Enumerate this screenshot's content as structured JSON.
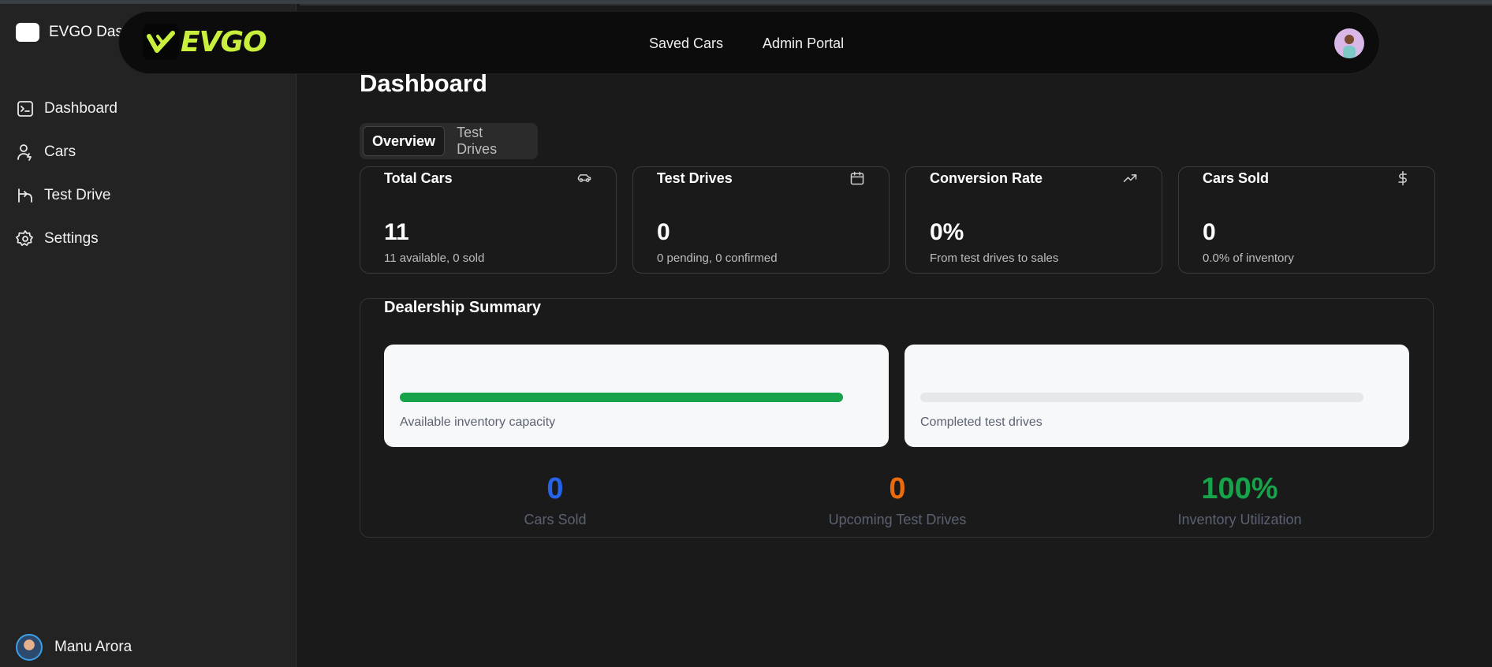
{
  "sidebar": {
    "brand": "EVGO Dash",
    "items": [
      {
        "label": "Dashboard"
      },
      {
        "label": "Cars"
      },
      {
        "label": "Test Drive"
      },
      {
        "label": "Settings"
      }
    ],
    "user_name": "Manu Arora"
  },
  "header": {
    "logo_text": "EVGO",
    "links": [
      "Saved Cars",
      "Admin Portal"
    ]
  },
  "page": {
    "title": "Dashboard",
    "tabs": [
      {
        "label": "Overview",
        "active": true
      },
      {
        "label": "Test Drives",
        "active": false
      }
    ]
  },
  "cards": [
    {
      "title": "Total Cars",
      "icon": "car-icon",
      "value": "11",
      "sub": "11 available, 0 sold"
    },
    {
      "title": "Test Drives",
      "icon": "calendar-icon",
      "value": "0",
      "sub": "0 pending, 0 confirmed"
    },
    {
      "title": "Conversion Rate",
      "icon": "trending-up-icon",
      "value": "0%",
      "sub": "From test drives to sales"
    },
    {
      "title": "Cars Sold",
      "icon": "dollar-icon",
      "value": "0",
      "sub": "0.0% of inventory"
    }
  ],
  "summary": {
    "title": "Dealership Summary",
    "panels": [
      {
        "label": "Available inventory capacity",
        "progress": 1.0,
        "color": "#16a34a"
      },
      {
        "label": "Completed test drives",
        "progress": 0.0,
        "color": "#16a34a"
      }
    ],
    "stats": [
      {
        "value": "0",
        "label": "Cars Sold",
        "color": "#2563eb"
      },
      {
        "value": "0",
        "label": "Upcoming Test Drives",
        "color": "#ea6a0c"
      },
      {
        "value": "100%",
        "label": "Inventory Utilization",
        "color": "#16a34a"
      }
    ]
  },
  "colors": {
    "accent": "#c8f03c",
    "background": "#1a1a1a"
  }
}
